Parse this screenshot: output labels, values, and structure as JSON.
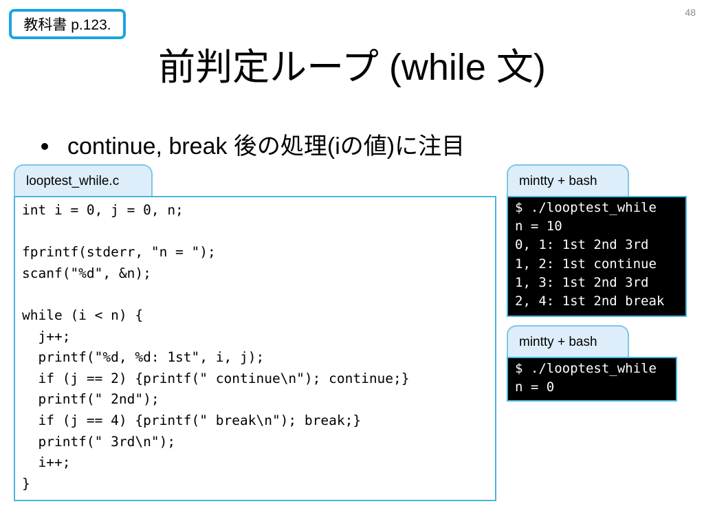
{
  "page_ref": "教科書 p.123.",
  "slide_number": "48",
  "title": "前判定ループ (while 文)",
  "bullet": "continue, break 後の処理(iの値)に注目",
  "source_panel": {
    "tab_label": "looptest_while.c",
    "code": [
      "int i = 0, j = 0, n;",
      "",
      "fprintf(stderr, \"n = \");",
      "scanf(\"%d\", &n);",
      "",
      "while (i < n) {",
      "  j++;",
      "  printf(\"%d, %d: 1st\", i, j);",
      "  if (j == 2) {printf(\" continue\\n\"); continue;}",
      "  printf(\" 2nd\");",
      "  if (j == 4) {printf(\" break\\n\"); break;}",
      "  printf(\" 3rd\\n\");",
      "  i++;",
      "}"
    ]
  },
  "terminals": [
    {
      "tab_label": "mintty + bash",
      "lines": [
        "$ ./looptest_while",
        "n = 10",
        "0, 1: 1st 2nd 3rd",
        "1, 2: 1st continue",
        "1, 3: 1st 2nd 3rd",
        "2, 4: 1st 2nd break"
      ]
    },
    {
      "tab_label": "mintty + bash",
      "lines": [
        "$ ./looptest_while",
        "n = 0"
      ]
    }
  ],
  "colors": {
    "accent_border": "#1ca3e0",
    "tab_fill": "#ddeefa",
    "terminal_bg": "#000000"
  }
}
